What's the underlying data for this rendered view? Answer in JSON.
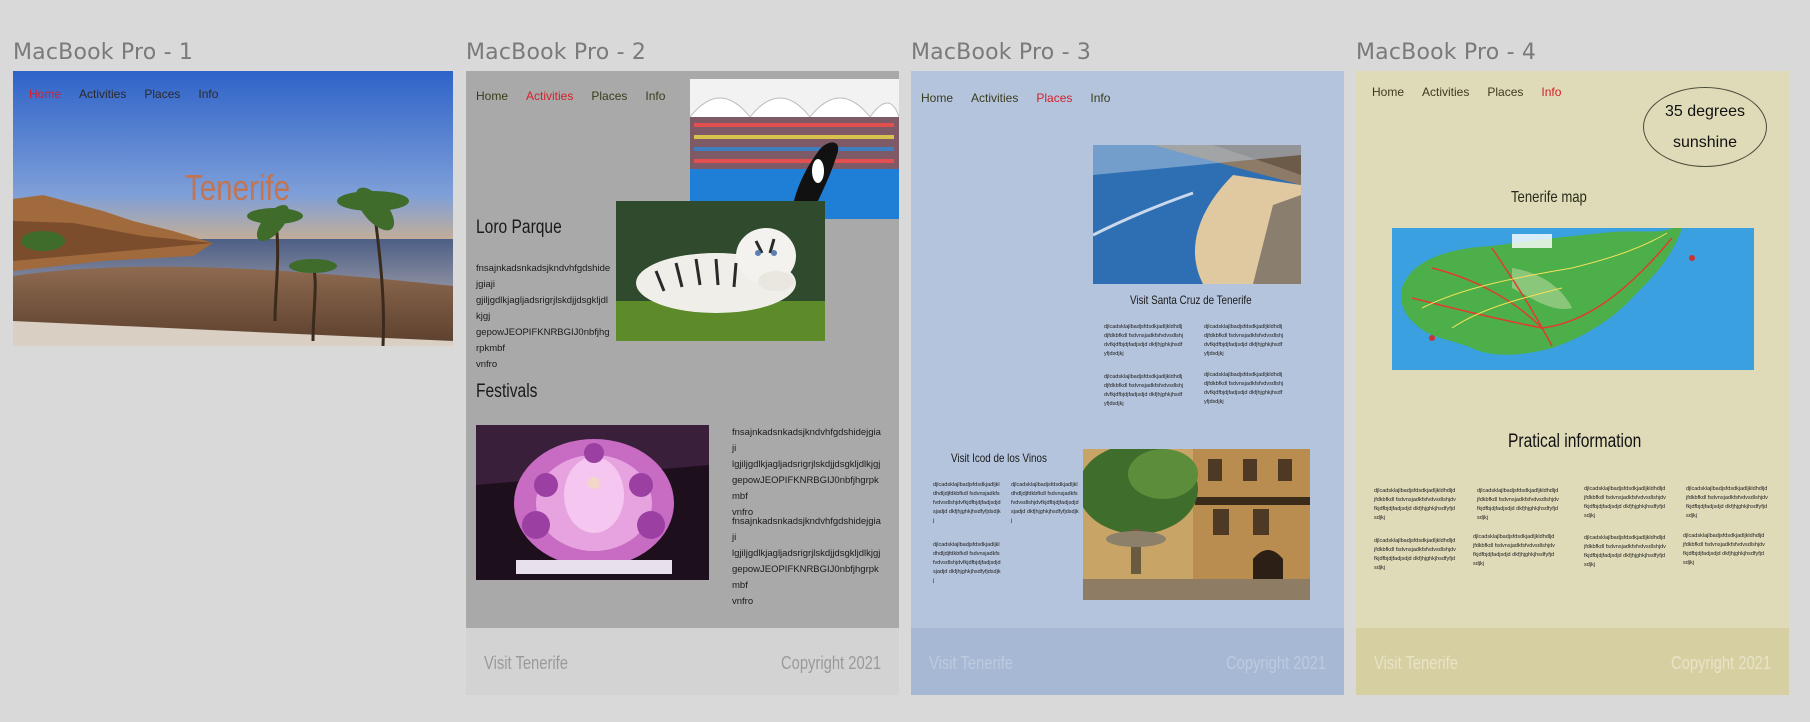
{
  "frames": {
    "f1": {
      "label": "MacBook Pro - 1",
      "nav": [
        "Home",
        "Activities",
        "Places",
        "Info"
      ],
      "active": 0,
      "hero_title": "Tenerife"
    },
    "f2": {
      "label": "MacBook Pro - 2",
      "nav": [
        "Home",
        "Activities",
        "Places",
        "Info"
      ],
      "active": 1,
      "section1_title": "Loro Parque",
      "section1_text": "fnsajnkadsnkadsjkndvhfgdshidejgiaji\ngjiljgdlkjagljadsrigrjlskdjjdsgkljdlkjgj\ngepowJEOPIFKNRBGIJ0nbfjhgrpkmbf\nvnfro",
      "section2_title": "Festivals",
      "section2_text1": "fnsajnkadsnkadsjkndvhfgdshidejgiaji\nlgjiljgdlkjagljadsrigrjlskdjjdsgkljdlkjgj\ngepowJEOPIFKNRBGIJ0nbfjhgrpkmbf\nvnfro",
      "section2_text2": "fnsajnkadsnkadsjkndvhfgdshidejgiaji\nlgjiljgdlkjagljadsrigrjlskdjjdsgkljdlkjgj\ngepowJEOPIFKNRBGIJ0nbfjhgrpkmbf\nvnfro",
      "footer_left": "Visit Tenerife",
      "footer_right": "Copyright 2021"
    },
    "f3": {
      "label": "MacBook Pro - 3",
      "nav": [
        "Home",
        "Activities",
        "Places",
        "Info"
      ],
      "active": 2,
      "title1": "Visit Santa Cruz de Tenerife",
      "title2": "Visit Icod de los Vinos",
      "tiny1": "djlcadsklajlbadjsfdsdkjadljkldhdljdjfdkbfkdl fsdvnsjadkfsfvdvsdlshjdvfkjdfbjdjfadjsdjd dkfjhjghkjhsdfyfjdsdjkj",
      "tiny2": "djlcadsklajlbadjsfdsdkjadljkldhdljdjfdkbfkdl fsdvnsjadkfsfvdvsdlshjdvfkjdfbjdjfadjsdjd dkfjhjghkjhsdfyfjdsdjkj",
      "tiny3": "djlcadsklajlbadjsfdsdkjadljkldhdljdjfdkbfkdl fsdvnsjadkfsfvdvsdlshjdvfkjdfbjdjfadjsdjd dkfjhjghkjhsdfyfjdsdjkj",
      "tiny4": "djlcadsklajlbadjsfdsdkjadljkldhdljdjfdkbfkdl fsdvnsjadkfsfvdvsdlshjdvfkjdfbjdjfadjsdjd dkfjhjghkjhsdfyfjdsdjkj",
      "tiny5": "djlcadsklajlbadjsfdsdkjadljkldhdljdjfdkbfkdl fsdvnsjadkfsfvdvsdlshjdvfkjdfbjdjfadjsdjd sjadjd dkfjhjghkjhsdfyfjdsdjkj",
      "tiny6": "djlcadsklajlbadjsfdsdkjadljkldhdljdjfdkbfkdl fsdvnsjadkfsfvdvsdlshjdvfkjdfbjdjfadjsdjd sjadjd dkfjhjghkjhsdfyfjdsdjkj",
      "tiny7": "djlcadsklajlbadjsfdsdkjadljkldhdljdjfdkbfkdl fsdvnsjadkfsfvdvsdlshjdvfkjdfbjdjfadjsdjd sjadjd dkfjhjghkjhsdfyfjdsdjkj",
      "footer_left": "Visit Tenerife",
      "footer_right": "Copyright 2021"
    },
    "f4": {
      "label": "MacBook Pro - 4",
      "nav": [
        "Home",
        "Activities",
        "Places",
        "Info"
      ],
      "active": 3,
      "weather_line1": "35 degrees",
      "weather_line2": "sunshine",
      "map_title": "Tenerife map",
      "info_title": "Pratical information",
      "tiny": [
        "djlcadsklajlbadjsfdsdkjadljkldhdljdjfdkbfkdl fsdvnsjadkfsfvdvsdlshjdvfkjdfbjdjfadjsdjd dkfjhjghkjhsdfyfjdsdjkj",
        "djlcadsklajlbadjsfdsdkjadljkldhdljdjfdkbfkdl fsdvnsjadkfsfvdvsdlshjdvfkjdfbjdjfadjsdjd dkfjhjghkjhsdfyfjdsdjkj",
        "djlcadsklajlbadjsfdsdkjadljkldhdljdjfdkbfkdl fsdvnsjadkfsfvdvsdlshjdvfkjdfbjdjfadjsdjd dkfjhjghkjhsdfyfjdsdjkj",
        "djlcadsklajlbadjsfdsdkjadljkldhdljdjfdkbfkdl fsdvnsjadkfsfvdvsdlshjdvfkjdfbjdjfadjsdjd dkfjhjghkjhsdfyfjdsdjkj",
        "djlcadsklajlbadjsfdsdkjadljkldhdljdjfdkbfkdl fsdvnsjadkfsfvdvsdlshjdvfkjdfbjdjfadjsdjd dkfjhjghkjhsdfyfjdsdjkj",
        "djlcadsklajlbadjsfdsdkjadljkldhdljdjfdkbfkdl fsdvnsjadkfsfvdvsdlshjdvfkjdfbjdjfadjsdjd dkfjhjghkjhsdfyfjdsdjkj",
        "djlcadsklajlbadjsfdsdkjadljkldhdljdjfdkbfkdl fsdvnsjadkfsfvdvsdlshjdvfkjdfbjdjfadjsdjd dkfjhjghkjhsdfyfjdsdjkj",
        "djlcadsklajlbadjsfdsdkjadljkldhdljdjfdkbfkdl fsdvnsjadkfsfvdvsdlshjdvfkjdfbjdjfadjsdjd dkfjhjghkjhsdfyfjdsdjkj"
      ],
      "footer_left": "Visit Tenerife",
      "footer_right": "Copyright 2021"
    }
  },
  "colors": {
    "canvas": "#d9d9d9",
    "frame2_bg": "#a9a9a9",
    "frame3_bg": "#b4c4dc",
    "frame4_bg": "#dfdbb8",
    "active_nav": "#d4202a",
    "hero_title": "#c07555"
  }
}
